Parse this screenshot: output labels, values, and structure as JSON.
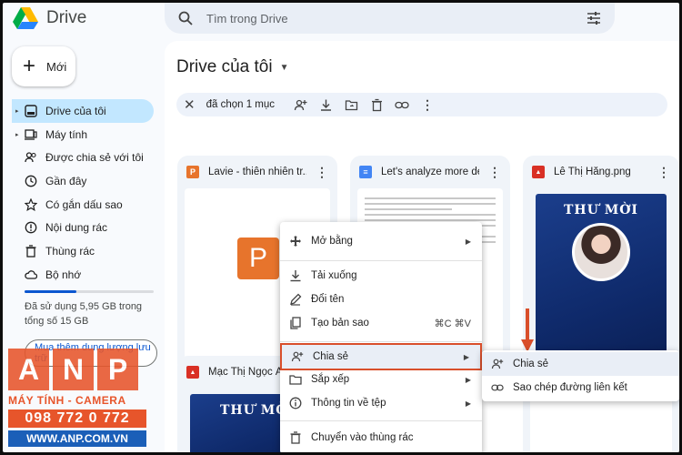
{
  "app": {
    "name": "Drive"
  },
  "search": {
    "placeholder": "Tìm trong Drive"
  },
  "new_button": {
    "label": "Mới"
  },
  "sidebar": {
    "items": [
      {
        "label": "Drive của tôi",
        "icon": "my-drive-icon",
        "active": true
      },
      {
        "label": "Máy tính",
        "icon": "computer-icon"
      },
      {
        "label": "Được chia sẻ với tôi",
        "icon": "shared-icon"
      },
      {
        "label": "Gần đây",
        "icon": "clock-icon"
      },
      {
        "label": "Có gắn dấu sao",
        "icon": "star-icon"
      },
      {
        "label": "Nội dung rác",
        "icon": "spam-icon"
      },
      {
        "label": "Thùng rác",
        "icon": "trash-icon"
      },
      {
        "label": "Bộ nhớ",
        "icon": "cloud-icon"
      }
    ],
    "storage": {
      "text": "Đã sử dụng 5,95 GB trong tổng số 15 GB",
      "used_fraction": 0.4
    },
    "buy_storage": "Mua thêm dung lượng lưu trữ"
  },
  "main": {
    "title": "Drive của tôi",
    "selection": {
      "count_label": "đã chọn 1 mục"
    },
    "files": [
      {
        "name": "Lavie - thiên nhiên tr...",
        "type": "slides",
        "badge": "P"
      },
      {
        "name": "Let's analyze more de...",
        "type": "doc",
        "badge": "≡"
      },
      {
        "name": "Lê Thị Hằng.png",
        "type": "image",
        "badge": "▲"
      },
      {
        "name": "Mạc Thị Ngọc Á",
        "type": "image",
        "badge": "▲"
      }
    ],
    "thumb_slides_letter": "P",
    "invite": {
      "title": "THƯ MỜI"
    }
  },
  "context_menu": {
    "items": [
      {
        "label": "Mở bằng",
        "icon": "move-icon",
        "submenu": true
      },
      {
        "label": "Tải xuống",
        "icon": "download-icon"
      },
      {
        "label": "Đổi tên",
        "icon": "rename-icon"
      },
      {
        "label": "Tạo bản sao",
        "icon": "copy-icon",
        "shortcut": "⌘C ⌘V"
      },
      {
        "label": "Chia sẻ",
        "icon": "share-icon",
        "submenu": true,
        "highlighted": true
      },
      {
        "label": "Sắp xếp",
        "icon": "folder-icon",
        "submenu": true
      },
      {
        "label": "Thông tin về tệp",
        "icon": "info-icon",
        "submenu": true
      },
      {
        "label": "Chuyển vào thùng rác",
        "icon": "trash-icon"
      }
    ]
  },
  "share_submenu": {
    "items": [
      {
        "label": "Chia sẻ",
        "icon": "add-person-icon"
      },
      {
        "label": "Sao chép đường liên kết",
        "icon": "link-icon"
      }
    ]
  },
  "watermark": {
    "letters": [
      "A",
      "N",
      "P"
    ],
    "tagline": "MÁY TÍNH - CAMERA",
    "phone": "098 772 0 772",
    "website": "WWW.ANP.COM.VN"
  },
  "colors": {
    "accent": "#0b57d0",
    "active_nav": "#c2e7ff",
    "highlight_border": "#d94f2b",
    "watermark": "#e7552b"
  }
}
